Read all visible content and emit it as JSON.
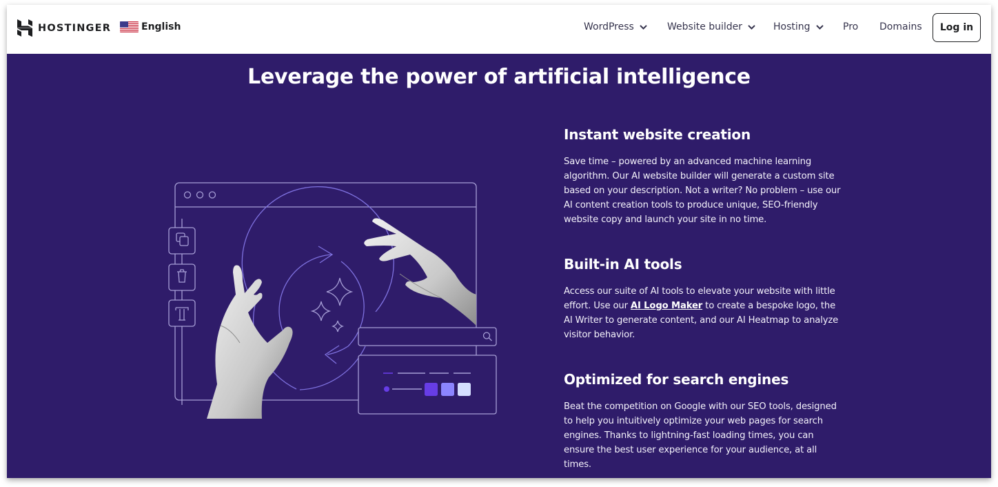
{
  "header": {
    "brand": "HOSTINGER",
    "language": {
      "label": "English",
      "flag": "us-flag-icon"
    },
    "nav": [
      {
        "label": "WordPress",
        "has_dropdown": true
      },
      {
        "label": "Website builder",
        "has_dropdown": true
      },
      {
        "label": "Hosting",
        "has_dropdown": true
      },
      {
        "label": "Pro",
        "has_dropdown": false
      },
      {
        "label": "Domains",
        "has_dropdown": false
      }
    ],
    "login_label": "Log in"
  },
  "main": {
    "title": "Leverage the power of artificial intelligence",
    "illustration": {
      "toolbar_icons": [
        "copy-icon",
        "trash-icon",
        "text-icon"
      ],
      "search_icon": "search-icon",
      "swatch_colors": [
        "#673de6",
        "#8c85ff",
        "#d5dfff"
      ],
      "accent_dot_color": "#673de6"
    },
    "features": [
      {
        "title": "Instant website creation",
        "text": "Save time – powered by an advanced machine learning algorithm. Our AI website builder will generate a custom site based on your description. Not a writer? No problem – use our AI content creation tools to produce unique, SEO-friendly website copy and launch your site in no time."
      },
      {
        "title": "Built-in AI tools",
        "text_before_link": "Access our suite of AI tools to elevate your website with little effort. Use our ",
        "link_label": "AI Logo Maker",
        "text_after_link": " to create a bespoke logo, the AI Writer to generate content, and our AI Heatmap to analyze visitor behavior."
      },
      {
        "title": "Optimized for search engines",
        "text": "Beat the competition on Google with our SEO tools, designed to help you intuitively optimize your web pages for search engines. Thanks to lightning-fast loading times, you can ensure the best user experience for your audience, at all times."
      }
    ]
  },
  "colors": {
    "background": "#2f1c6a",
    "header_bg": "#ffffff",
    "line_art": "#a79fd6",
    "accent": "#673de6"
  }
}
